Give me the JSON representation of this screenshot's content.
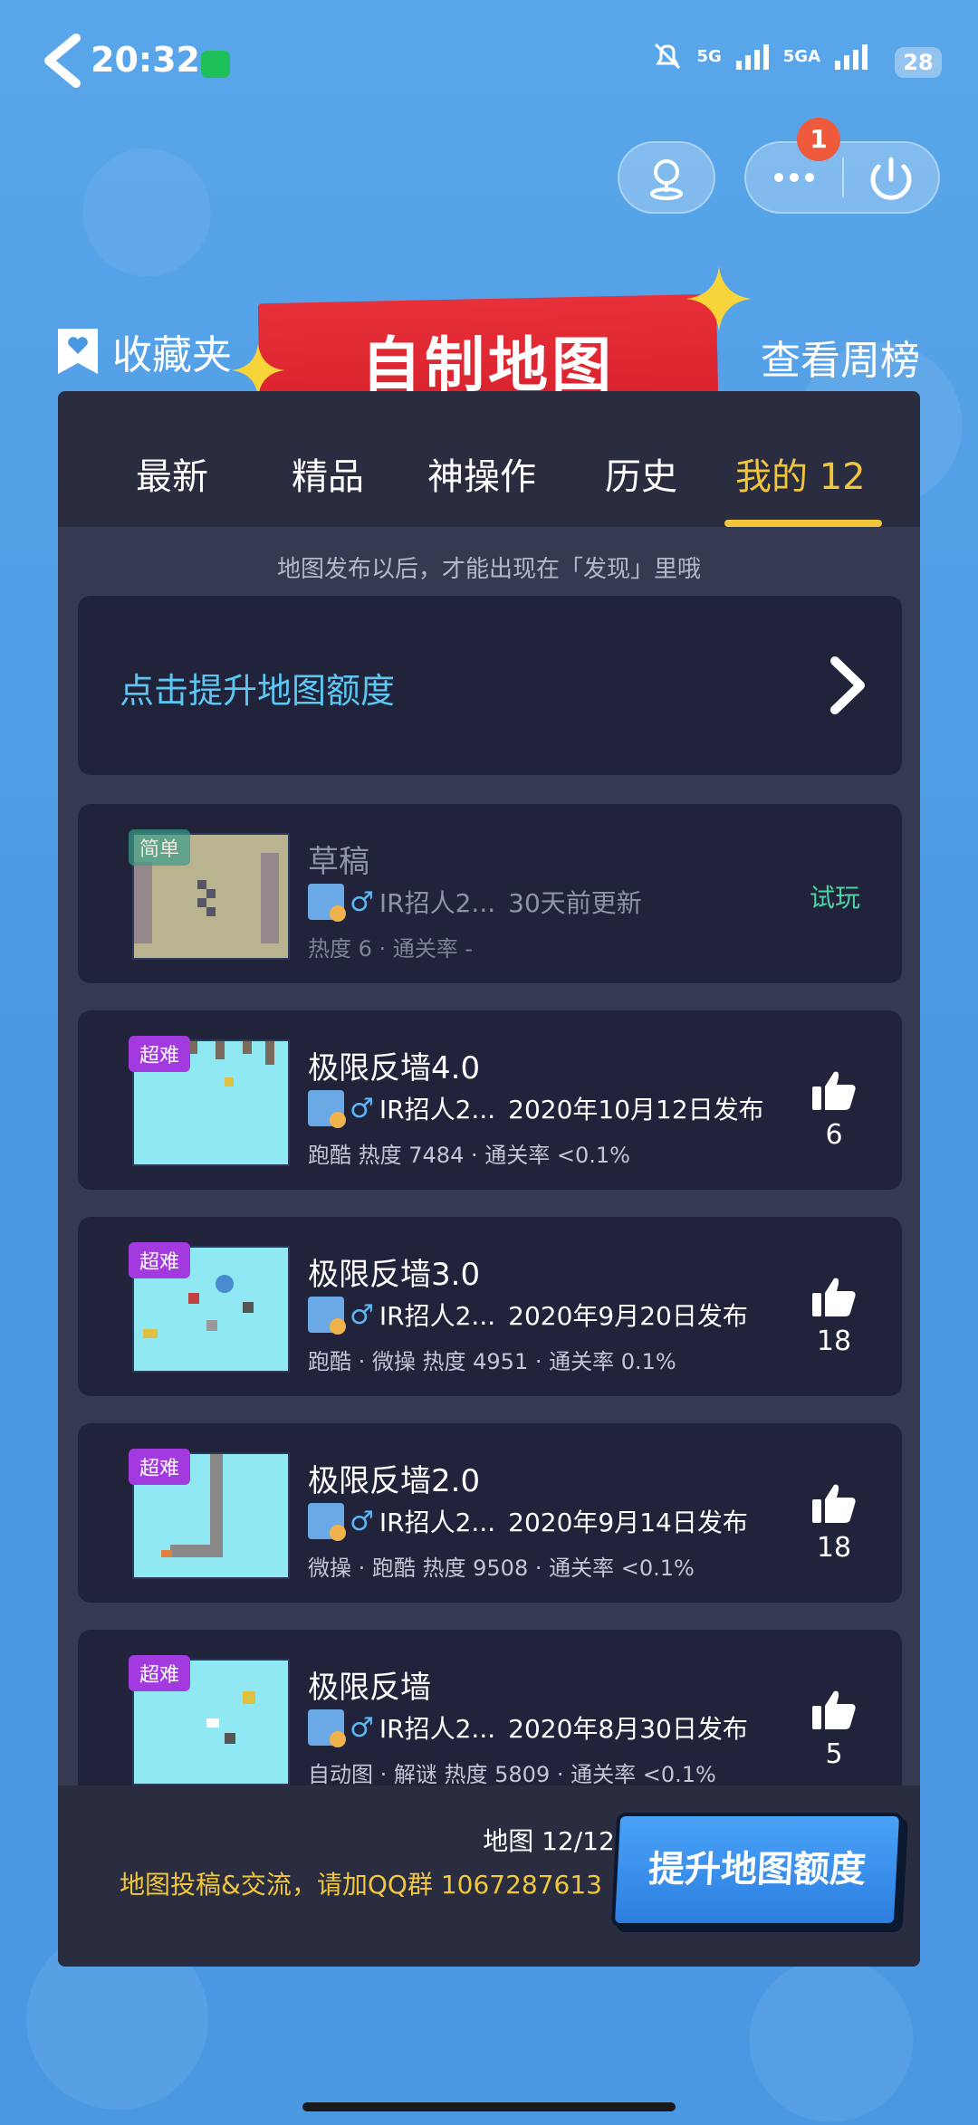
{
  "status_bar": {
    "time": "20:32",
    "network_1": "5G",
    "network_2": "5GA",
    "battery": "28"
  },
  "header": {
    "favorites_label": "收藏夹",
    "banner_title": "自制地图",
    "weekly_label": "查看周榜",
    "notification_count": "1"
  },
  "tabs": [
    {
      "label": "最新"
    },
    {
      "label": "精品"
    },
    {
      "label": "神操作"
    },
    {
      "label": "历史"
    },
    {
      "label": "我的 12"
    }
  ],
  "notice": "地图发布以后，才能出现在「发现」里哦",
  "boost_prompt": "点击提升地图额度",
  "maps": [
    {
      "difficulty": "简单",
      "title": "草稿",
      "author": "IR招人2...",
      "date": "30天前更新",
      "stats": "热度 6 · 通关率 -",
      "action": "试玩"
    },
    {
      "difficulty": "超难",
      "title": "极限反墙4.0",
      "author": "IR招人2...",
      "date": "2020年10月12日发布",
      "stats": "跑酷 热度 7484 · 通关率 <0.1%",
      "likes": "6"
    },
    {
      "difficulty": "超难",
      "title": "极限反墙3.0",
      "author": "IR招人2...",
      "date": "2020年9月20日发布",
      "stats": "跑酷 · 微操 热度 4951 · 通关率 0.1%",
      "likes": "18"
    },
    {
      "difficulty": "超难",
      "title": "极限反墙2.0",
      "author": "IR招人2...",
      "date": "2020年9月14日发布",
      "stats": "微操 · 跑酷 热度 9508 · 通关率 <0.1%",
      "likes": "18"
    },
    {
      "difficulty": "超难",
      "title": "极限反墙",
      "author": "IR招人2...",
      "date": "2020年8月30日发布",
      "stats": "自动图 · 解谜 热度 5809 · 通关率 <0.1%",
      "likes": "5"
    }
  ],
  "footer": {
    "quota": "地图 12/12",
    "qq_group": "地图投稿&交流，请加QQ群 1067287613",
    "boost_button": "提升地图额度"
  },
  "colors": {
    "background": "#4a98e2",
    "panel": "#363a50",
    "card": "#20233a",
    "accent": "#f2c63b",
    "link": "#5cc7f3",
    "difficulty_hard": "#a33ae0"
  }
}
